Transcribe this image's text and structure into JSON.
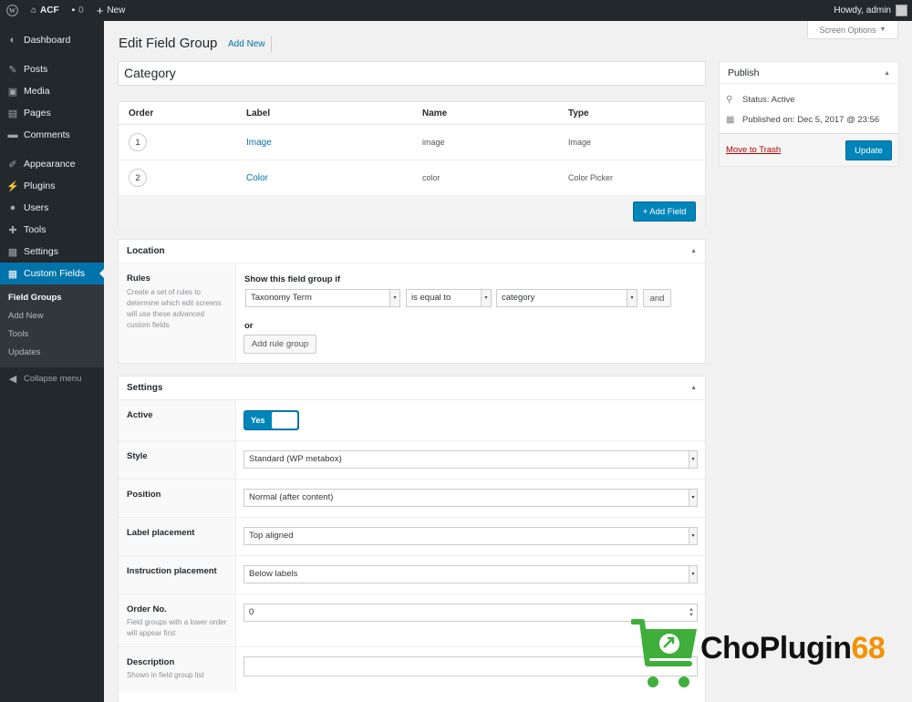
{
  "adminbar": {
    "site_name": "ACF",
    "comments_count": "0",
    "new_label": "New",
    "howdy": "Howdy, admin"
  },
  "sidebar": {
    "items": [
      {
        "label": "Dashboard",
        "icon": "dashboard-icon"
      },
      {
        "label": "Posts",
        "icon": "pin-icon"
      },
      {
        "label": "Media",
        "icon": "media-icon"
      },
      {
        "label": "Pages",
        "icon": "pages-icon"
      },
      {
        "label": "Comments",
        "icon": "comment-icon"
      },
      {
        "label": "Appearance",
        "icon": "brush-icon"
      },
      {
        "label": "Plugins",
        "icon": "plugin-icon"
      },
      {
        "label": "Users",
        "icon": "users-icon"
      },
      {
        "label": "Tools",
        "icon": "wrench-icon"
      },
      {
        "label": "Settings",
        "icon": "settings-icon"
      },
      {
        "label": "Custom Fields",
        "icon": "custom-fields-icon"
      }
    ],
    "submenu": [
      "Field Groups",
      "Add New",
      "Tools",
      "Updates"
    ],
    "collapse": "Collapse menu"
  },
  "header": {
    "title": "Edit Field Group",
    "add_new": "Add New",
    "screen_options": "Screen Options"
  },
  "title_value": "Category",
  "fields_table": {
    "headers": [
      "Order",
      "Label",
      "Name",
      "Type"
    ],
    "rows": [
      {
        "order": "1",
        "label": "Image",
        "name": "image",
        "type": "Image"
      },
      {
        "order": "2",
        "label": "Color",
        "name": "color",
        "type": "Color Picker"
      }
    ],
    "add_field": "+ Add Field"
  },
  "location": {
    "title": "Location",
    "rules_label": "Rules",
    "rules_desc": "Create a set of rules to determine which edit screens will use these advanced custom fields",
    "show_if": "Show this field group if",
    "param": "Taxonomy Term",
    "operator": "is equal to",
    "value": "category",
    "and": "and",
    "or": "or",
    "add_rule_group": "Add rule group"
  },
  "settings": {
    "title": "Settings",
    "active_label": "Active",
    "active_value": "Yes",
    "style_label": "Style",
    "style_value": "Standard (WP metabox)",
    "position_label": "Position",
    "position_value": "Normal (after content)",
    "label_placement_label": "Label placement",
    "label_placement_value": "Top aligned",
    "instruction_label": "Instruction placement",
    "instruction_value": "Below labels",
    "order_label": "Order No.",
    "order_desc": "Field groups with a lower order will appear first",
    "order_value": "0",
    "description_label": "Description",
    "description_desc": "Shown in field group list"
  },
  "publish": {
    "title": "Publish",
    "status": "Status: Active",
    "published": "Published on: Dec 5, 2017 @ 23:56",
    "trash": "Move to Trash",
    "update": "Update"
  },
  "watermark": {
    "text_main": "ChoPlugin",
    "text_accent": "68"
  },
  "colors": {
    "accent": "#0085ba",
    "sidebar": "#23282d",
    "watermark_green": "#3fae3a",
    "watermark_orange": "#f39200"
  }
}
